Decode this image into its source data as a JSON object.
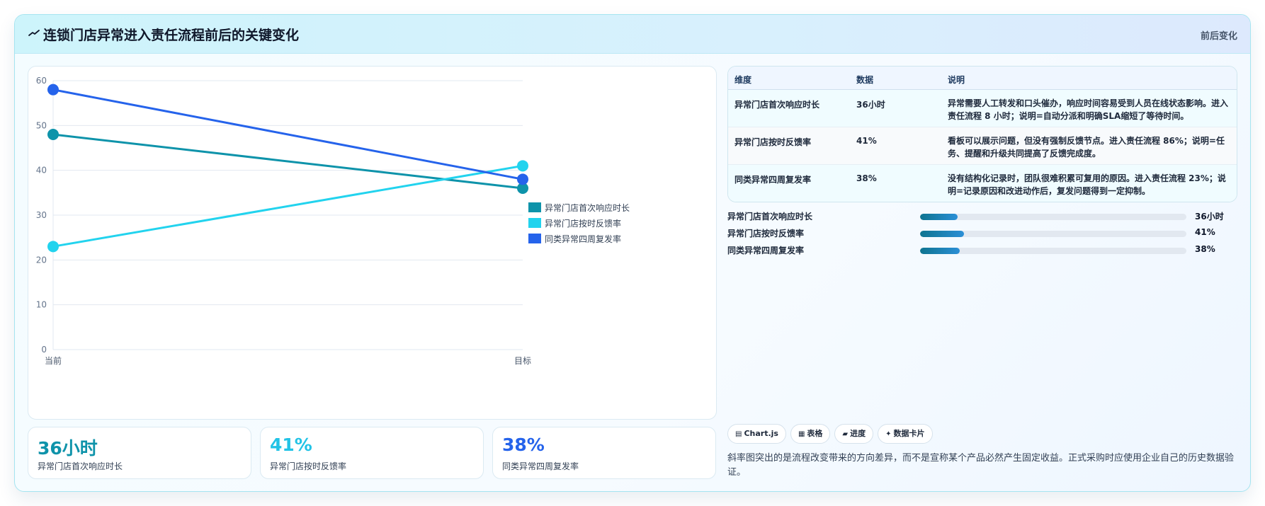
{
  "header": {
    "icon": "trend-icon",
    "title": "连锁门店异常进入责任流程前后的关键变化",
    "tag": "前后变化"
  },
  "chart_data": {
    "type": "line",
    "categories": [
      "当前",
      "目标"
    ],
    "ylim": [
      0,
      60
    ],
    "yticks": [
      0,
      10,
      20,
      30,
      40,
      50,
      60
    ],
    "grid": true,
    "legend_position": "right",
    "series": [
      {
        "name": "异常门店首次响应时长",
        "values": [
          48,
          36
        ],
        "color": "#0e93aa"
      },
      {
        "name": "异常门店按时反馈率",
        "values": [
          23,
          41
        ],
        "color": "#22d3ee"
      },
      {
        "name": "同类异常四周复发率",
        "values": [
          58,
          38
        ],
        "color": "#2563eb"
      }
    ]
  },
  "kpis": [
    {
      "value": "36小时",
      "label": "异常门店首次响应时长",
      "color": "#0e93aa"
    },
    {
      "value": "41%",
      "label": "异常门店按时反馈率",
      "color": "#22c3e6"
    },
    {
      "value": "38%",
      "label": "同类异常四周复发率",
      "color": "#2563eb"
    }
  ],
  "table": {
    "headers": [
      "维度",
      "数据",
      "说明"
    ],
    "rows": [
      {
        "dimension": "异常门店首次响应时长",
        "data": "36小时",
        "note": "异常需要人工转发和口头催办，响应时间容易受到人员在线状态影响。进入责任流程 8 小时；说明=自动分派和明确SLA缩短了等待时间。"
      },
      {
        "dimension": "异常门店按时反馈率",
        "data": "41%",
        "note": "看板可以展示问题，但没有强制反馈节点。进入责任流程 86%；说明=任务、提醒和升级共同提高了反馈完成度。"
      },
      {
        "dimension": "同类异常四周复发率",
        "data": "38%",
        "note": "没有结构化记录时，团队很难积累可复用的原因。进入责任流程 23%；说明=记录原因和改进动作后，复发问题得到一定抑制。"
      }
    ]
  },
  "progress": [
    {
      "label": "异常门店首次响应时长",
      "value": "36小时",
      "fraction": 0.14
    },
    {
      "label": "异常门店按时反馈率",
      "value": "41%",
      "fraction": 0.165
    },
    {
      "label": "同类异常四周复发率",
      "value": "38%",
      "fraction": 0.15
    }
  ],
  "chips": [
    {
      "icon": "chart-icon",
      "glyph": "▤",
      "label": "Chart.js"
    },
    {
      "icon": "table-icon",
      "glyph": "▦",
      "label": "表格"
    },
    {
      "icon": "progress-icon",
      "glyph": "▰",
      "label": "进度"
    },
    {
      "icon": "sparkle-icon",
      "glyph": "✦",
      "label": "数据卡片"
    }
  ],
  "footnote": "斜率图突出的是流程改变带来的方向差异，而不是宣称某个产品必然产生固定收益。正式采购时应使用企业自己的历史数据验证。"
}
